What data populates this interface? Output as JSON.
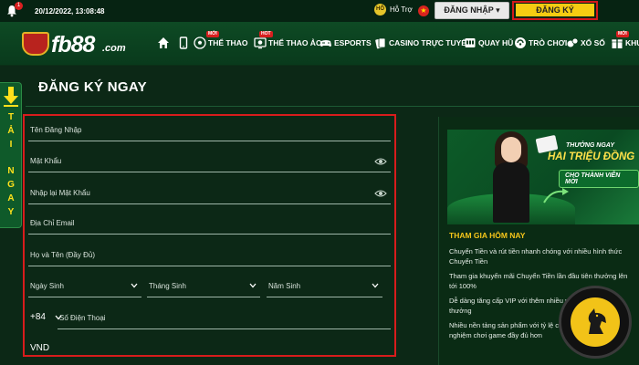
{
  "topbar": {
    "notification_count": "1",
    "datetime": "20/12/2022, 13:08:48",
    "support_icon": "HỖ",
    "support_label": "Hỗ Trợ",
    "flag_icon": "vn-flag-icon",
    "login_label": "ĐĂNG NHẬP ▾",
    "register_label": "ĐĂNG KÝ"
  },
  "logo": {
    "text": "fb88",
    "suffix": ".com"
  },
  "nav": {
    "items": [
      {
        "label": "",
        "icon": "home-icon"
      },
      {
        "label": "",
        "icon": "mobile-icon"
      },
      {
        "label": "THỂ THAO",
        "icon": "soccer-ball-icon",
        "badge": "MỚI"
      },
      {
        "label": "THỂ THAO ẢO",
        "icon": "virtual-sports-icon",
        "badge": "HOT"
      },
      {
        "label": "ESPORTS",
        "icon": "gamepad-icon"
      },
      {
        "label": "CASINO TRỰC TUYẾN",
        "icon": "cards-icon"
      },
      {
        "label": "QUAY HŨ",
        "icon": "slot-machine-icon"
      },
      {
        "label": "TRÒ CHƠI",
        "icon": "games-icon"
      },
      {
        "label": "XỔ SỐ",
        "icon": "lottery-icon"
      },
      {
        "label": "KHU",
        "icon": "promo-icon",
        "badge": "MỚI"
      }
    ]
  },
  "download_tab": {
    "letters": [
      "T",
      "Ả",
      "I",
      "N",
      "G",
      "A",
      "Y"
    ]
  },
  "page": {
    "title": "ĐĂNG KÝ NGAY"
  },
  "form": {
    "username_label": "Tên Đăng Nhập",
    "password_label": "Mật Khẩu",
    "confirm_password_label": "Nhập lại Mật Khẩu",
    "email_label": "Địa Chỉ Email",
    "fullname_label": "Họ và Tên (Đầy Đủ)",
    "birth_day_label": "Ngày Sinh",
    "birth_month_label": "Tháng Sinh",
    "birth_year_label": "Năm Sinh",
    "phone_prefix": "+84",
    "phone_label": "Số Điện Thoại",
    "currency": "VND"
  },
  "promo": {
    "banner_line1": "THƯỞNG NGAY",
    "banner_line2": "HAI TRIỆU ĐỒNG",
    "banner_line3": "CHO THÀNH VIÊN MỚI",
    "heading": "THAM GIA HÔM NAY",
    "paragraphs": [
      "Chuyển Tiền và rút tiền nhanh chóng với nhiều hình thức Chuyển Tiền",
      "Tham gia khuyến mãi Chuyển Tiền lần đầu tiên thưởng lên tới 100%",
      "Dễ dàng tăng cấp VIP với thêm nhiều ưu đãi cùng giải thưởng",
      "Nhiều nền tảng sản phẩm với tỷ lệ cược cạnh tranh và trải nghiệm chơi game đầy đủ hơn"
    ]
  },
  "colors": {
    "accent_yellow": "#f6cc12",
    "header_bg": "#062312",
    "nav_bg": "#0e4a24",
    "highlight_red": "#d81c1c"
  }
}
